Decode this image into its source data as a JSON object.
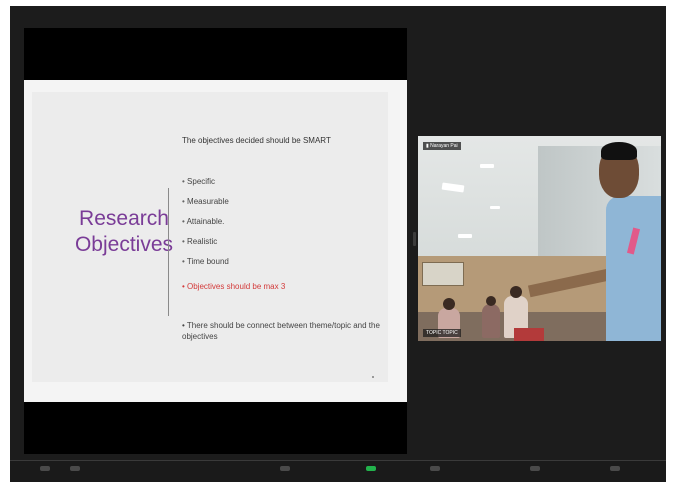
{
  "slide": {
    "title": "Research Objectives",
    "heading": "The objectives decided should be SMART",
    "bullets": [
      "Specific",
      "Measurable",
      "Attainable.",
      "Realistic",
      "Time bound"
    ],
    "highlight": "Objectives should be max 3",
    "note": "There should be connect between theme/topic and the objectives"
  },
  "video": {
    "top_label": "Narayan Pai",
    "bottom_label": "TOPIC TOPIC"
  },
  "colors": {
    "title": "#7a3c97",
    "highlight": "#d33a3a",
    "window_bg": "#1c1c1c",
    "active_control": "#22b24c"
  },
  "icons": [
    "camera-indicator-icon"
  ]
}
